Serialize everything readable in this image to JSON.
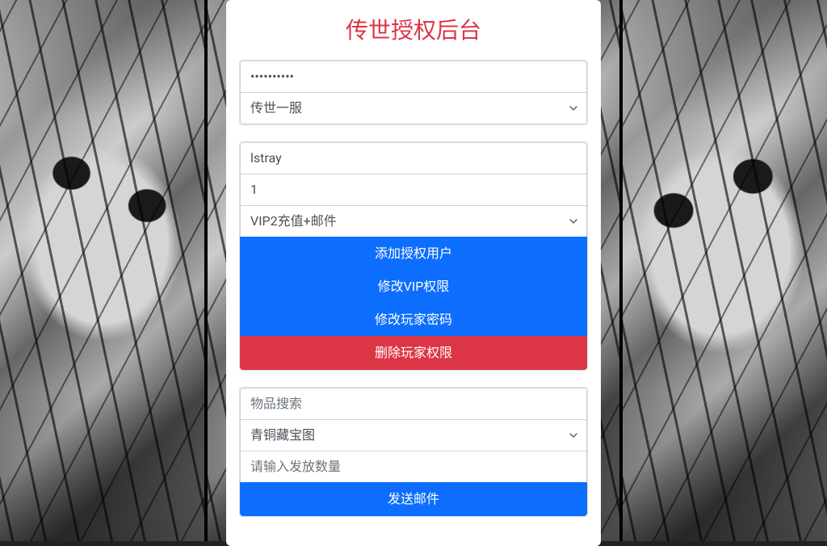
{
  "page_title": "传世授权后台",
  "section1": {
    "password_value": "••••••••••",
    "server_select": "传世一服"
  },
  "section2": {
    "username_value": "lstray",
    "number_value": "1",
    "vip_select": "VIP2充值+邮件",
    "btn_add_user": "添加授权用户",
    "btn_modify_vip": "修改VIP权限",
    "btn_modify_password": "修改玩家密码",
    "btn_delete_permission": "删除玩家权限"
  },
  "section3": {
    "item_search_placeholder": "物品搜索",
    "item_select": "青铜藏宝图",
    "quantity_placeholder": "请输入发放数量",
    "btn_send_mail": "发送邮件"
  }
}
